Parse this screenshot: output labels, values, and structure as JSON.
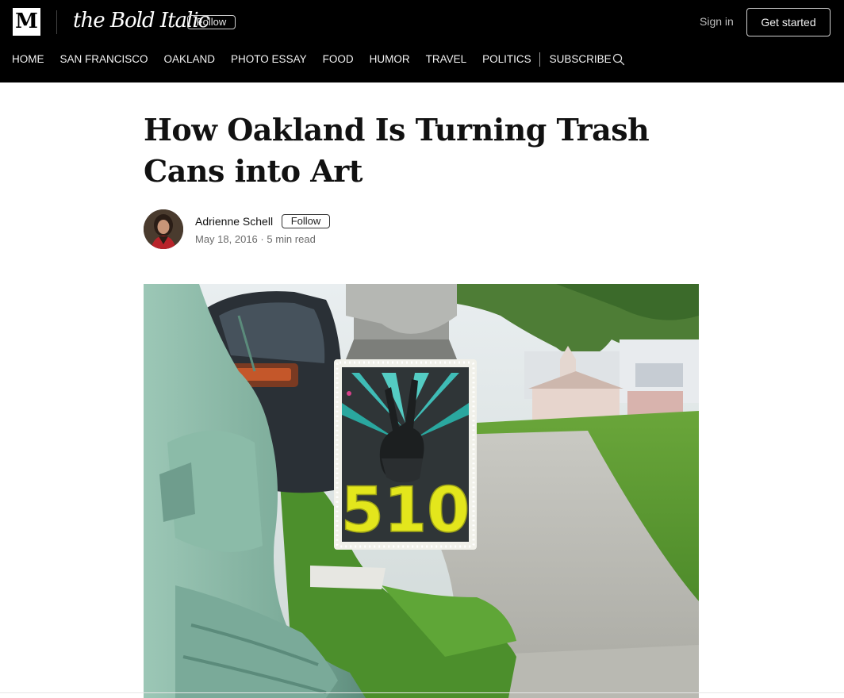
{
  "header": {
    "medium_logo": "M",
    "publication_name": "the Bold Italic",
    "publication_follow": "Follow",
    "sign_in": "Sign in",
    "get_started": "Get started"
  },
  "nav": {
    "items": [
      "HOME",
      "SAN FRANCISCO",
      "OAKLAND",
      "PHOTO ESSAY",
      "FOOD",
      "HUMOR",
      "TRAVEL",
      "POLITICS"
    ],
    "subscribe": "SUBSCRIBE",
    "search_icon": "search-icon"
  },
  "article": {
    "title": "How Oakland Is Turning Trash Cans into Art",
    "author": "Adrienne Schell",
    "author_follow": "Follow",
    "date": "May 18, 2016",
    "separator": "·",
    "read_time": "5 min read",
    "hero_text": "510"
  },
  "colors": {
    "header_bg": "#000000",
    "page_bg": "#ffffff",
    "title_text": "#111111",
    "meta_text": "#6b6b6b",
    "mosaic_yellow": "#e3e61c",
    "mosaic_teal": "#3fbcb6"
  }
}
